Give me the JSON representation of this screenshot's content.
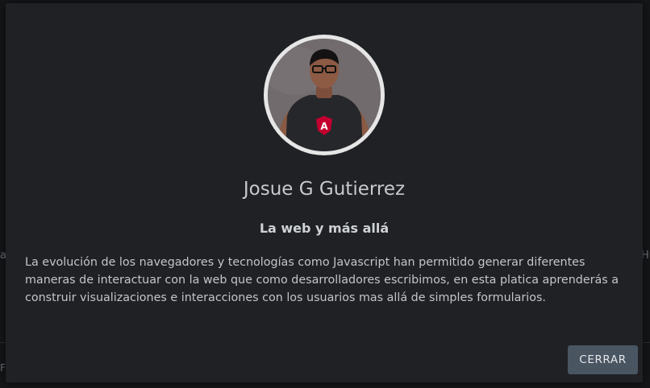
{
  "background": {
    "left_edge_text": "a",
    "right_edge_text": "Hu",
    "bottom_edge_text": "F"
  },
  "modal": {
    "speaker_name": "Josue G Gutierrez",
    "talk_title": "La web y más allá",
    "description": "La evolución de los navegadores y tecnologías como Javascript han permitido generar diferentes maneras de interactuar con la web que como desarrolladores escribimos, en esta platica aprenderás a construir visualizaciones e interacciones con los usuarios mas allá de simples formularios.",
    "close_label": "CERRAR"
  },
  "colors": {
    "modal_bg": "#1f2125",
    "button_bg": "#4a5562",
    "avatar_ring": "#e6e6e6",
    "shirt_logo": "#c3002f"
  }
}
